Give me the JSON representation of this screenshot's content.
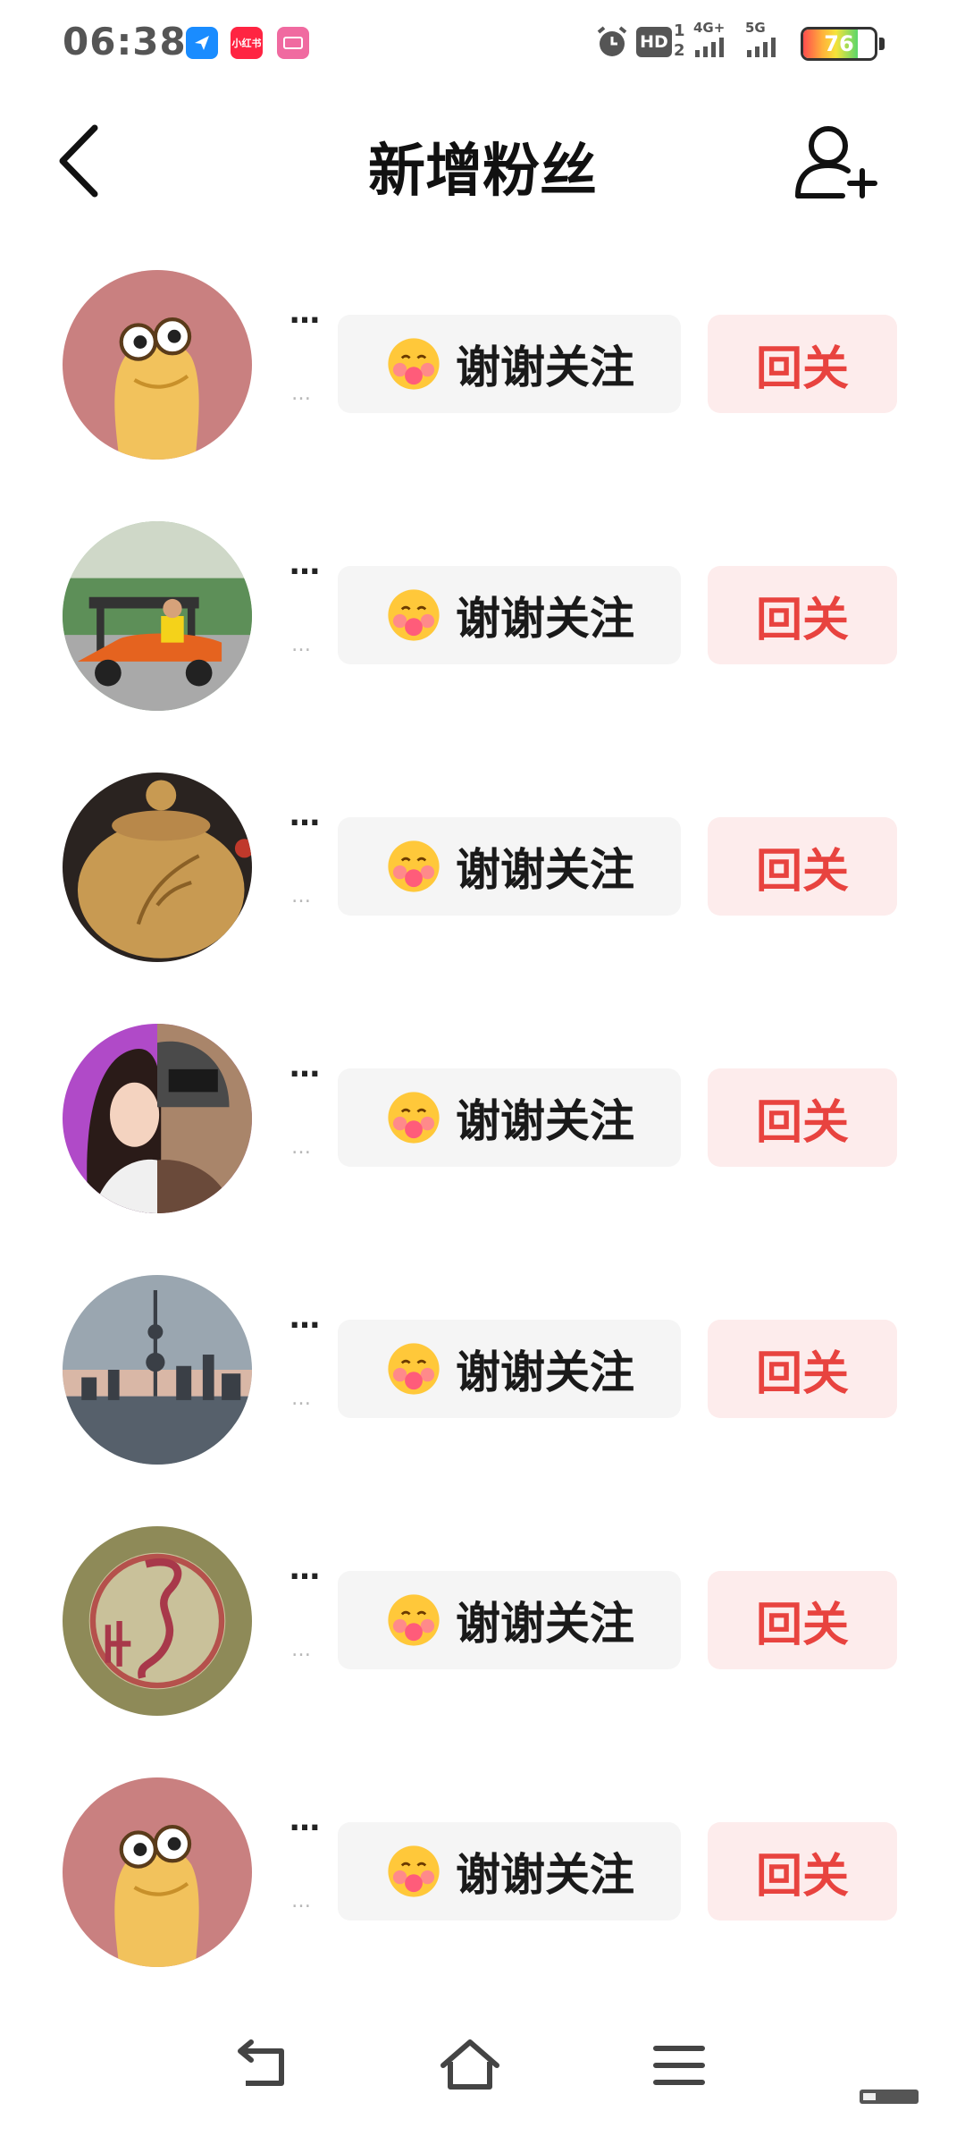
{
  "status_bar": {
    "time": "06:38",
    "app_badges": [
      {
        "name": "blue-app-icon",
        "label": "",
        "color": "#1a8cff"
      },
      {
        "name": "xiaohongshu-icon",
        "label": "小红书",
        "color": "#ff2442"
      },
      {
        "name": "pink-app-icon",
        "label": "",
        "color": "#f06aa0"
      }
    ],
    "hd_label": "HD",
    "sim1_label": "1",
    "sim2_label": "2",
    "net1_label": "4G+",
    "net2_label": "5G",
    "battery": "76",
    "battery_level": 0.76
  },
  "header": {
    "title": "新增粉丝",
    "back_icon": "chevron-left-icon",
    "add_icon": "add-user-icon"
  },
  "fans": [
    {
      "name_top": "…",
      "name_sub": "…",
      "thanks": "谢谢关注",
      "follow_back": "回关",
      "avatar": "cartoon-creature-avatar"
    },
    {
      "name_top": "…",
      "name_sub": "…",
      "thanks": "谢谢关注",
      "follow_back": "回关",
      "avatar": "golf-cart-photo-avatar"
    },
    {
      "name_top": "…",
      "name_sub": "…",
      "thanks": "谢谢关注",
      "follow_back": "回关",
      "avatar": "teapot-photo-avatar"
    },
    {
      "name_top": "…",
      "name_sub": "…",
      "thanks": "谢谢关注",
      "follow_back": "回关",
      "avatar": "anime-girl-avatar"
    },
    {
      "name_top": "…",
      "name_sub": "…",
      "thanks": "谢谢关注",
      "follow_back": "回关",
      "avatar": "city-skyline-avatar"
    },
    {
      "name_top": "…",
      "name_sub": "…",
      "thanks": "谢谢关注",
      "follow_back": "回关",
      "avatar": "calligraphy-seal-avatar"
    },
    {
      "name_top": "…",
      "name_sub": "…",
      "thanks": "谢谢关注",
      "follow_back": "回关",
      "avatar": "cartoon-creature-avatar"
    }
  ],
  "colors": {
    "accent_red": "#e8433f",
    "follow_back_bg": "#fdecec",
    "thanks_bg": "#f5f5f5"
  },
  "nav_bar": {
    "back_icon": "nav-back-icon",
    "home_icon": "nav-home-icon",
    "menu_icon": "nav-menu-icon"
  }
}
